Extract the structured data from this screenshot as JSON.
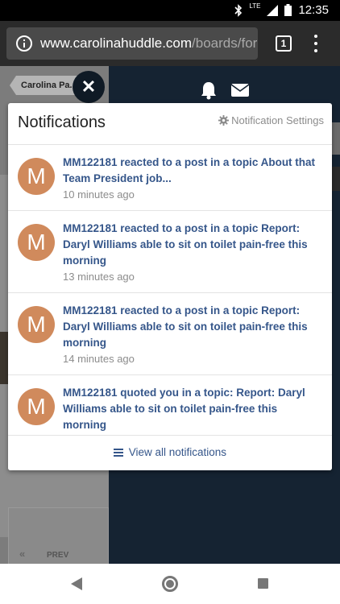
{
  "status_bar": {
    "time": "12:35",
    "network": "LTE"
  },
  "browser": {
    "url_domain": "www.carolinahuddle.com",
    "url_path": "/boards/for",
    "tab_count": "1"
  },
  "background": {
    "breadcrumb_label": "Carolina Pa...",
    "prev_label": "PREV",
    "prev_chevron": "«"
  },
  "header_icons": {
    "close_glyph": "✕"
  },
  "notifications": {
    "title": "Notifications",
    "settings_label": "Notification Settings",
    "items": [
      {
        "avatar_letter": "M",
        "text": "MM122181 reacted to a post in a topic About that Team President job...",
        "time": "10 minutes ago"
      },
      {
        "avatar_letter": "M",
        "text": "MM122181 reacted to a post in a topic Report: Daryl Williams able to sit on toilet pain-free this morning",
        "time": "13 minutes ago"
      },
      {
        "avatar_letter": "M",
        "text": "MM122181 reacted to a post in a topic Report: Daryl Williams able to sit on toilet pain-free this morning",
        "time": "14 minutes ago"
      },
      {
        "avatar_letter": "M",
        "text": "MM122181 quoted you in a topic: Report: Daryl Williams able to sit on toilet pain-free this morning",
        "time": ""
      }
    ],
    "view_all_label": "View all notifications"
  },
  "colors": {
    "link": "#35568a",
    "avatar": "#d08a5c",
    "page_dark": "#152332"
  }
}
